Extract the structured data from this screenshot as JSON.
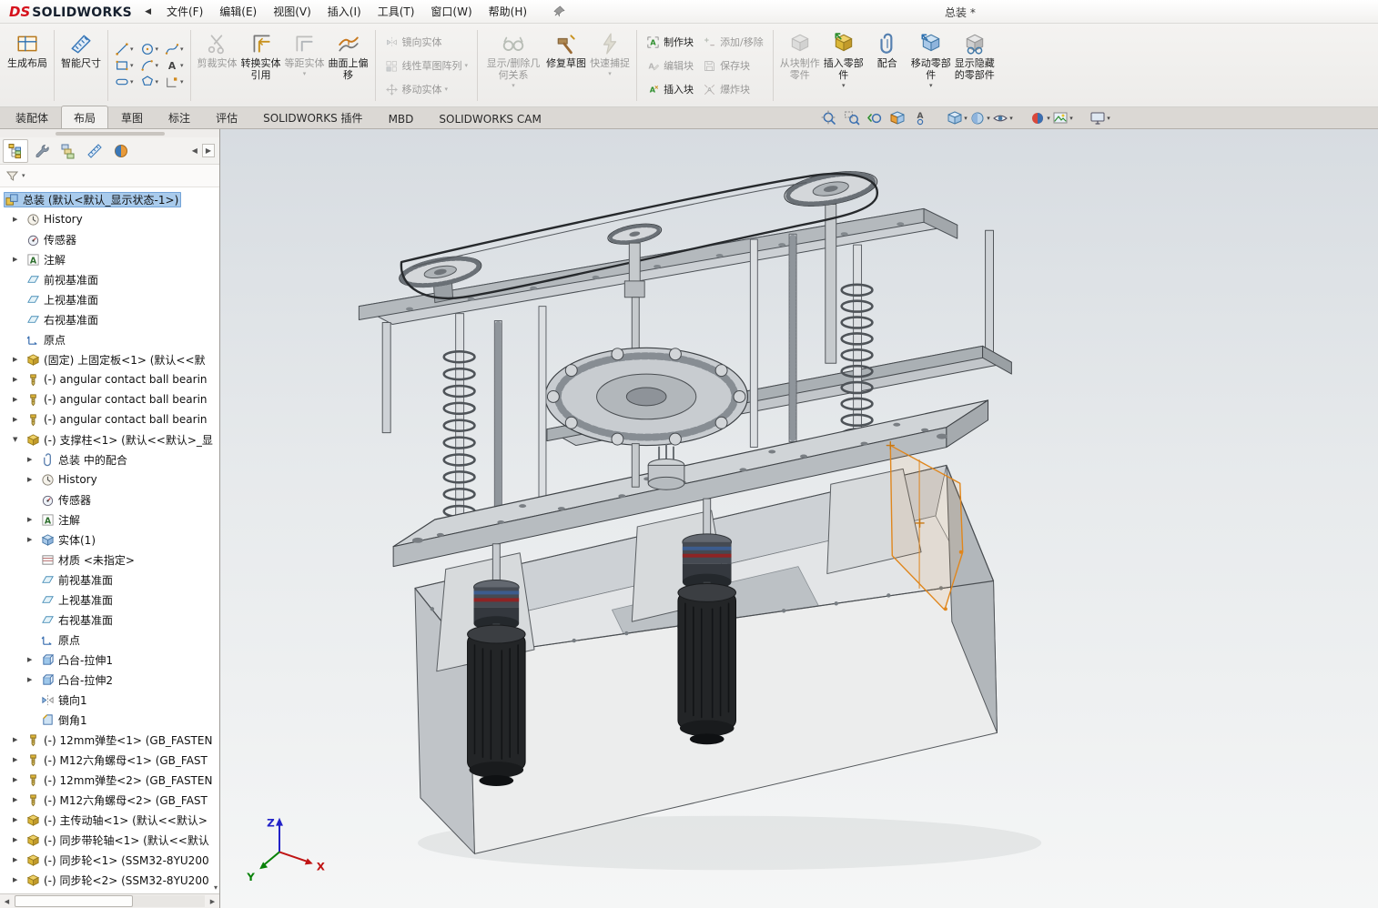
{
  "app": {
    "brand_ds": "DS",
    "brand_name": "SOLIDWORKS",
    "doc_title": "总装 *"
  },
  "menubar": {
    "items": [
      {
        "id": "file",
        "label": "文件(F)"
      },
      {
        "id": "edit",
        "label": "编辑(E)"
      },
      {
        "id": "view",
        "label": "视图(V)"
      },
      {
        "id": "insert",
        "label": "插入(I)"
      },
      {
        "id": "tools",
        "label": "工具(T)"
      },
      {
        "id": "window",
        "label": "窗口(W)"
      },
      {
        "id": "help",
        "label": "帮助(H)"
      }
    ]
  },
  "ribbon": {
    "groups": [
      {
        "name": "layout",
        "layout": "large",
        "buttons": [
          {
            "id": "make-layout",
            "label": "生成布局",
            "disabled": false
          }
        ]
      },
      {
        "name": "dimension",
        "layout": "large",
        "buttons": [
          {
            "id": "smart-dimension",
            "label": "智能尺寸",
            "disabled": false
          }
        ]
      },
      {
        "name": "sketch-entities",
        "layout": "sketchgrid",
        "buttons": [
          {
            "id": "sketch-line"
          },
          {
            "id": "sketch-circle"
          },
          {
            "id": "sketch-spline"
          },
          {
            "id": "sketch-rectangle"
          },
          {
            "id": "sketch-arc"
          },
          {
            "id": "sketch-text"
          },
          {
            "id": "sketch-slot"
          },
          {
            "id": "sketch-polygon"
          },
          {
            "id": "sketch-point"
          }
        ]
      },
      {
        "name": "sketch-tools",
        "layout": "large",
        "buttons": [
          {
            "id": "trim-entities",
            "label": "剪裁实体",
            "disabled": true
          },
          {
            "id": "convert-entities",
            "label": "转换实体引用",
            "disabled": false
          },
          {
            "id": "offset-entities",
            "label": "等距实体",
            "disabled": true,
            "dd": true
          },
          {
            "id": "surface-offset",
            "label": "曲面上偏移",
            "disabled": false
          }
        ]
      },
      {
        "name": "sketch-pattern",
        "layout": "stack",
        "buttons": [
          {
            "id": "mirror-entities",
            "label": "镜向实体",
            "disabled": true
          },
          {
            "id": "linear-sketch-pattern",
            "label": "线性草图阵列",
            "disabled": true,
            "dd": true
          },
          {
            "id": "move-entities",
            "label": "移动实体",
            "disabled": true,
            "dd": true
          }
        ]
      },
      {
        "name": "relations",
        "layout": "large",
        "buttons": [
          {
            "id": "display-delete-relations",
            "label": "显示/删除几何关系",
            "disabled": true,
            "dd": true,
            "wide": true
          },
          {
            "id": "repair-sketch",
            "label": "修复草图",
            "disabled": false
          },
          {
            "id": "quick-snaps",
            "label": "快速捕捉",
            "disabled": true,
            "dd": true
          }
        ]
      },
      {
        "name": "blocks",
        "layout": "stack2",
        "buttons": [
          {
            "id": "make-block",
            "label": "制作块",
            "disabled": false
          },
          {
            "id": "edit-block",
            "label": "编辑块",
            "disabled": true
          },
          {
            "id": "insert-block",
            "label": "插入块",
            "disabled": false
          },
          {
            "id": "add-remove-entities",
            "label": "添加/移除",
            "disabled": true
          },
          {
            "id": "save-block",
            "label": "保存块",
            "disabled": true
          },
          {
            "id": "explode-block",
            "label": "爆炸块",
            "disabled": true
          }
        ]
      },
      {
        "name": "assembly",
        "layout": "large",
        "buttons": [
          {
            "id": "part-from-block",
            "label": "从块制作零件",
            "disabled": true
          },
          {
            "id": "insert-components",
            "label": "插入零部件",
            "disabled": false,
            "dd": true
          },
          {
            "id": "mate",
            "label": "配合",
            "disabled": false
          },
          {
            "id": "move-component",
            "label": "移动零部件",
            "disabled": false,
            "dd": true
          },
          {
            "id": "show-hidden-components",
            "label": "显示隐藏的零部件",
            "disabled": false
          }
        ]
      }
    ]
  },
  "tabs": {
    "items": [
      {
        "label": "装配体",
        "active": false
      },
      {
        "label": "布局",
        "active": true
      },
      {
        "label": "草图",
        "active": false
      },
      {
        "label": "标注",
        "active": false
      },
      {
        "label": "评估",
        "active": false
      },
      {
        "label": "SOLIDWORKS 插件",
        "active": false
      },
      {
        "label": "MBD",
        "active": false
      },
      {
        "label": "SOLIDWORKS CAM",
        "active": false
      }
    ]
  },
  "headsup": {
    "items": [
      {
        "id": "zoom-to-fit"
      },
      {
        "id": "zoom-to-area"
      },
      {
        "id": "previous-view"
      },
      {
        "id": "section-view"
      },
      {
        "id": "annotation-views"
      },
      {
        "id": "view-orientation",
        "dd": true,
        "gap": true
      },
      {
        "id": "display-style",
        "dd": true
      },
      {
        "id": "hide-show-items",
        "dd": true
      },
      {
        "id": "edit-appearance",
        "dd": true,
        "gap": true
      },
      {
        "id": "apply-scene",
        "dd": true
      },
      {
        "id": "view-settings",
        "dd": true,
        "gap": true
      }
    ]
  },
  "sidebar": {
    "panel_tabs": [
      {
        "id": "feature-manager",
        "active": true
      },
      {
        "id": "property-manager",
        "active": false
      },
      {
        "id": "configuration-manager",
        "active": false
      },
      {
        "id": "dimxpert-manager",
        "active": false
      },
      {
        "id": "display-manager",
        "active": false
      }
    ]
  },
  "tree": {
    "items": [
      {
        "lvl": 0,
        "icon": "assembly",
        "arrow": "",
        "sel": true,
        "label": "总装 (默认<默认_显示状态-1>)"
      },
      {
        "lvl": 1,
        "icon": "history",
        "arrow": "r",
        "label": "History"
      },
      {
        "lvl": 1,
        "icon": "sensor",
        "arrow": "",
        "label": "传感器"
      },
      {
        "lvl": 1,
        "icon": "annotation",
        "arrow": "r",
        "label": "注解"
      },
      {
        "lvl": 1,
        "icon": "plane",
        "arrow": "",
        "label": "前视基准面"
      },
      {
        "lvl": 1,
        "icon": "plane",
        "arrow": "",
        "label": "上视基准面"
      },
      {
        "lvl": 1,
        "icon": "plane",
        "arrow": "",
        "label": "右视基准面"
      },
      {
        "lvl": 1,
        "icon": "origin",
        "arrow": "",
        "label": "原点"
      },
      {
        "lvl": 1,
        "icon": "part",
        "arrow": "r",
        "label": "(固定) 上固定板<1> (默认<<默"
      },
      {
        "lvl": 1,
        "icon": "fastener",
        "arrow": "r",
        "label": "(-) angular contact ball bearin"
      },
      {
        "lvl": 1,
        "icon": "fastener",
        "arrow": "r",
        "label": "(-) angular contact ball bearin"
      },
      {
        "lvl": 1,
        "icon": "fastener",
        "arrow": "r",
        "label": "(-) angular contact ball bearin"
      },
      {
        "lvl": 1,
        "icon": "part",
        "arrow": "d",
        "label": "(-) 支撑柱<1> (默认<<默认>_显"
      },
      {
        "lvl": 2,
        "icon": "mates",
        "arrow": "r",
        "label": "总装 中的配合"
      },
      {
        "lvl": 2,
        "icon": "history",
        "arrow": "r",
        "label": "History"
      },
      {
        "lvl": 2,
        "icon": "sensor",
        "arrow": "",
        "label": "传感器"
      },
      {
        "lvl": 2,
        "icon": "annotation",
        "arrow": "r",
        "label": "注解"
      },
      {
        "lvl": 2,
        "icon": "body",
        "arrow": "r",
        "label": "实体(1)"
      },
      {
        "lvl": 2,
        "icon": "material",
        "arrow": "",
        "label": "材质 <未指定>"
      },
      {
        "lvl": 2,
        "icon": "plane",
        "arrow": "",
        "label": "前视基准面"
      },
      {
        "lvl": 2,
        "icon": "plane",
        "arrow": "",
        "label": "上视基准面"
      },
      {
        "lvl": 2,
        "icon": "plane",
        "arrow": "",
        "label": "右视基准面"
      },
      {
        "lvl": 2,
        "icon": "origin",
        "arrow": "",
        "label": "原点"
      },
      {
        "lvl": 2,
        "icon": "extrude",
        "arrow": "r",
        "label": "凸台-拉伸1"
      },
      {
        "lvl": 2,
        "icon": "extrude",
        "arrow": "r",
        "label": "凸台-拉伸2"
      },
      {
        "lvl": 2,
        "icon": "mirrorf",
        "arrow": "",
        "label": "镜向1"
      },
      {
        "lvl": 2,
        "icon": "chamfer",
        "arrow": "",
        "label": "倒角1"
      },
      {
        "lvl": 1,
        "icon": "fastener",
        "arrow": "r",
        "label": "(-) 12mm弹垫<1> (GB_FASTEN"
      },
      {
        "lvl": 1,
        "icon": "fastener",
        "arrow": "r",
        "label": "(-) M12六角螺母<1> (GB_FAST"
      },
      {
        "lvl": 1,
        "icon": "fastener",
        "arrow": "r",
        "label": "(-) 12mm弹垫<2> (GB_FASTEN"
      },
      {
        "lvl": 1,
        "icon": "fastener",
        "arrow": "r",
        "label": "(-) M12六角螺母<2> (GB_FAST"
      },
      {
        "lvl": 1,
        "icon": "part",
        "arrow": "r",
        "label": "(-) 主传动轴<1> (默认<<默认>"
      },
      {
        "lvl": 1,
        "icon": "part",
        "arrow": "r",
        "label": "(-) 同步带轮轴<1> (默认<<默认"
      },
      {
        "lvl": 1,
        "icon": "part",
        "arrow": "r",
        "label": "(-) 同步轮<1> (SSM32-8YU200"
      },
      {
        "lvl": 1,
        "icon": "part",
        "arrow": "r",
        "label": "(-) 同步轮<2> (SSM32-8YU200"
      }
    ]
  },
  "viewport": {
    "triad": {
      "x": "X",
      "y": "Y",
      "z": "Z"
    }
  },
  "colors": {
    "selection_blue": "#a9cbec",
    "brand_red": "#d6121c",
    "sketch_orange": "#e0861c",
    "disabled_gray": "#9a9a9a"
  }
}
